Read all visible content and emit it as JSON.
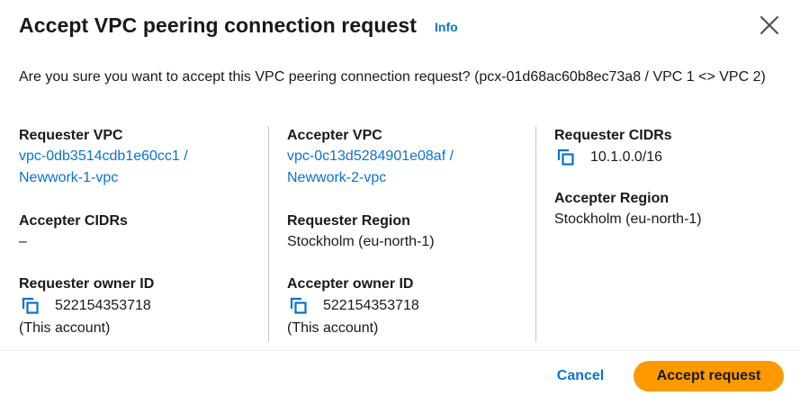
{
  "dialog": {
    "title": "Accept VPC peering connection request",
    "info_label": "Info",
    "question": "Are you sure you want to accept this VPC peering connection request? (pcx-01d68ac60b8ec73a8 / VPC 1 <> VPC 2)"
  },
  "details": {
    "requester_vpc": {
      "label": "Requester VPC",
      "line1": "vpc-0db3514cdb1e60cc1 /",
      "line2": "Newwork-1-vpc"
    },
    "accepter_cidrs": {
      "label": "Accepter CIDRs",
      "value": "–"
    },
    "requester_owner": {
      "label": "Requester owner ID",
      "value": "522154353718",
      "note": "(This account)"
    },
    "accepter_vpc": {
      "label": "Accepter VPC",
      "line1": "vpc-0c13d5284901e08af /",
      "line2": "Newwork-2-vpc"
    },
    "requester_region": {
      "label": "Requester Region",
      "value": "Stockholm (eu-north-1)"
    },
    "accepter_owner": {
      "label": "Accepter owner ID",
      "value": "522154353718",
      "note": "(This account)"
    },
    "requester_cidrs": {
      "label": "Requester CIDRs",
      "value": "10.1.0.0/16"
    },
    "accepter_region": {
      "label": "Accepter Region",
      "value": "Stockholm (eu-north-1)"
    }
  },
  "footer": {
    "cancel_label": "Cancel",
    "accept_label": "Accept request"
  },
  "icons": {
    "close": "close-icon",
    "copy": "copy-icon"
  },
  "colors": {
    "link": "#0972d3",
    "primary_button": "#ff9900",
    "text": "#16191f",
    "divider": "#c6c6cd"
  }
}
